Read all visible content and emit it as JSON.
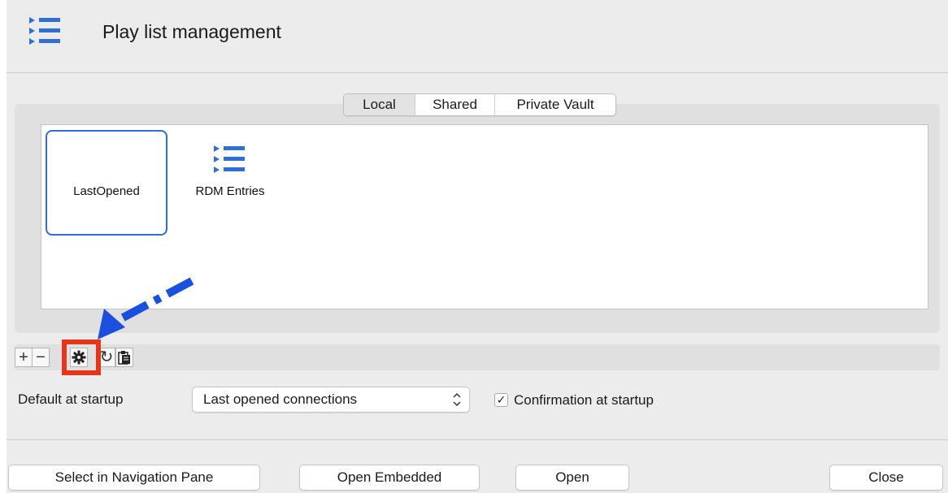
{
  "window": {
    "title": "Play list management",
    "icon": "playlist-icon",
    "accent_color": "#2f6fd3"
  },
  "tabs": [
    {
      "label": "Local",
      "active": true
    },
    {
      "label": "Shared",
      "active": false
    },
    {
      "label": "Private Vault",
      "active": false
    }
  ],
  "playlists": [
    {
      "label": "LastOpened",
      "icon": null,
      "selected": true
    },
    {
      "label": "RDM Entries",
      "icon": "playlist-icon",
      "selected": false
    }
  ],
  "toolbar": {
    "add": "+",
    "remove": "−",
    "settings": "✱",
    "refresh": "↻",
    "paste": "📋"
  },
  "annotation": {
    "highlight_color": "#e5361b",
    "arrow_color": "#1a4fe0"
  },
  "startup": {
    "label": "Default at startup",
    "selected_option": "Last opened connections",
    "select_arrows": "⌃⌄"
  },
  "confirmation": {
    "label": "Confirmation at startup",
    "checked": true,
    "check_glyph": "✓"
  },
  "footer": {
    "select_in_nav": "Select in Navigation Pane",
    "open_embedded": "Open Embedded",
    "open": "Open",
    "close": "Close"
  }
}
